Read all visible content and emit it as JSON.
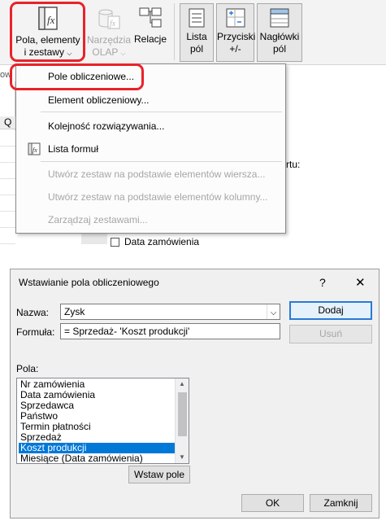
{
  "ribbon": {
    "btn_fields_line1": "Pola, elementy",
    "btn_fields_line2": "i zestawy",
    "btn_olap_line1": "Narzędzia",
    "btn_olap_line2": "OLAP",
    "btn_relations": "Relacje",
    "btn_field_list_line1": "Lista",
    "btn_field_list_line2": "pól",
    "btn_buttons_line1": "Przyciski",
    "btn_buttons_line2": "+/-",
    "btn_headers_line1": "Nagłówki",
    "btn_headers_line2": "pól",
    "left_cut": "ow",
    "sheet_q": "Q"
  },
  "menu": {
    "items": [
      {
        "label": "Pole obliczeniowe...",
        "enabled": true
      },
      {
        "label": "Element obliczeniowy...",
        "enabled": true
      },
      {
        "label": "Kolejność rozwiązywania...",
        "enabled": true
      },
      {
        "label": "Lista formuł",
        "enabled": true
      },
      {
        "label": "Utwórz zestaw na podstawie elementów wiersza...",
        "enabled": false
      },
      {
        "label": "Utwórz zestaw na podstawie elementów kolumny...",
        "enabled": false
      },
      {
        "label": "Zarządzaj zestawami...",
        "enabled": false
      }
    ],
    "right_peek": "rtu:",
    "bottom_peek": "Data zamówienia"
  },
  "dialog": {
    "title": "Wstawianie pola obliczeniowego",
    "help_glyph": "?",
    "close_glyph": "✕",
    "name_label": "Nazwa:",
    "name_value": "Zysk",
    "formula_label": "Formuła:",
    "formula_value": "= Sprzedaż- 'Koszt produkcji'",
    "add_button": "Dodaj",
    "delete_button": "Usuń",
    "fields_label": "Pola:",
    "fields": [
      "Nr zamówienia",
      "Data zamówienia",
      "Sprzedawca",
      "Państwo",
      "Termin płatności",
      "Sprzedaż",
      "Koszt produkcji",
      "Miesiące (Data zamówienia)"
    ],
    "selected_field": "Koszt produkcji",
    "insert_field_button": "Wstaw pole",
    "ok_button": "OK",
    "close_button": "Zamknij"
  },
  "colors": {
    "highlight_red": "#e8232a",
    "selection_blue": "#0078d7",
    "default_button_border": "#2a7ad5"
  }
}
